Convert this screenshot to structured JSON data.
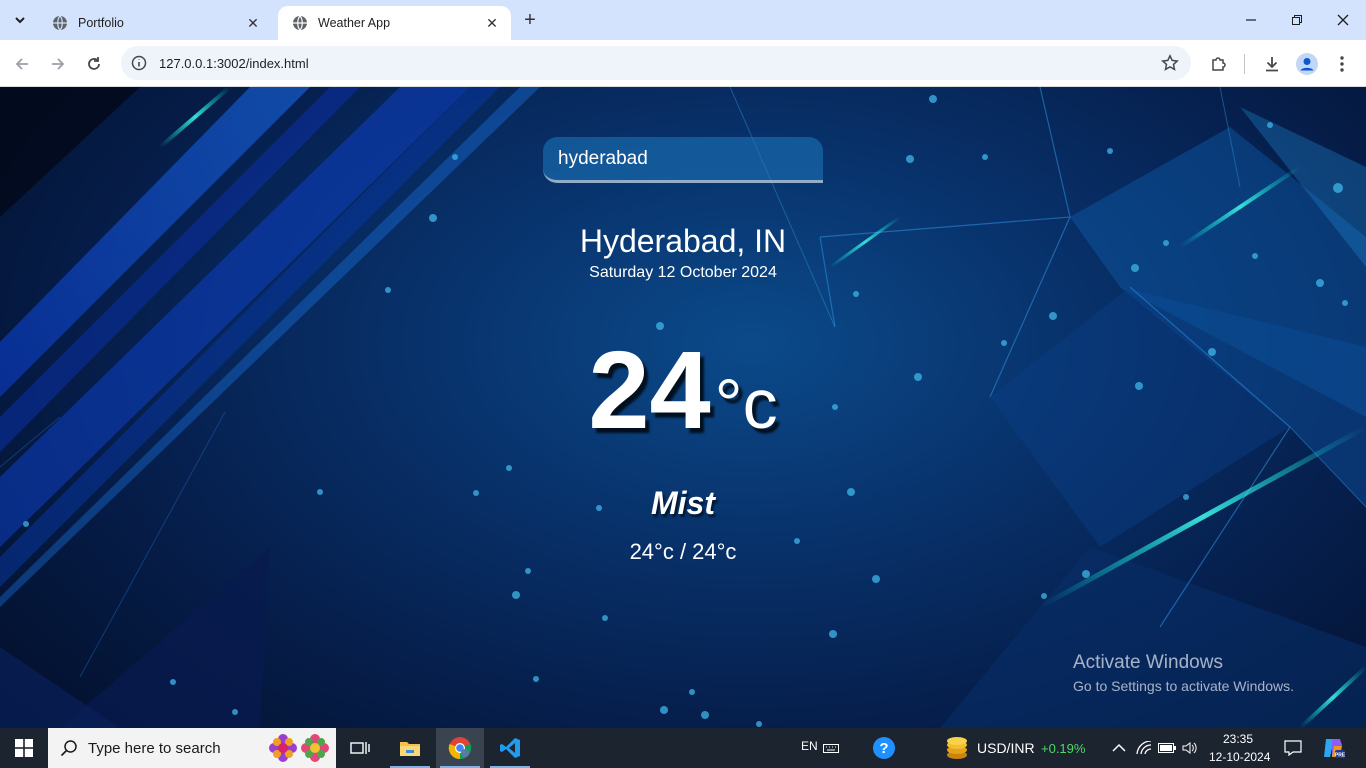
{
  "browser": {
    "tabs": [
      {
        "title": "Portfolio",
        "active": false
      },
      {
        "title": "Weather App",
        "active": true
      }
    ],
    "url": "127.0.0.1:3002/index.html"
  },
  "app": {
    "search_value": "hyderabad",
    "city": "Hyderabad, IN",
    "date": "Saturday 12 October 2024",
    "temperature": "24",
    "temp_unit": "°c",
    "weather": "Mist",
    "hi_low": "24°c / 24°c"
  },
  "watermark": {
    "title": "Activate Windows",
    "subtitle": "Go to Settings to activate Windows."
  },
  "taskbar": {
    "search_placeholder": "Type here to search",
    "language": "EN",
    "ticker_name": "USD/INR",
    "ticker_change": "+0.19%",
    "ticker_change_color": "#4cd964",
    "time": "23:35",
    "date": "12-10-2024"
  }
}
